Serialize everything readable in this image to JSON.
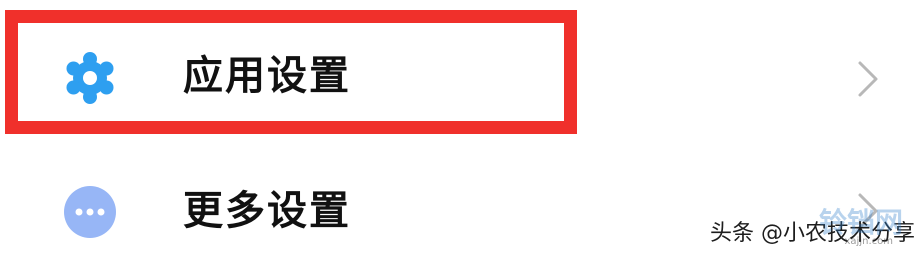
{
  "settings_list": {
    "items": [
      {
        "label": "应用设置",
        "icon": "gear-icon",
        "icon_color": "#2e9ff0",
        "highlighted": true
      },
      {
        "label": "更多设置",
        "icon": "more-dots-icon",
        "icon_color": "#97b6f6",
        "highlighted": false
      }
    ]
  },
  "annotation": {
    "highlight_color": "#f0302b"
  },
  "watermark": {
    "text": "头条 @小农技术分享",
    "logo_text": "铃铛网",
    "logo_sub": "xajjn.com"
  }
}
